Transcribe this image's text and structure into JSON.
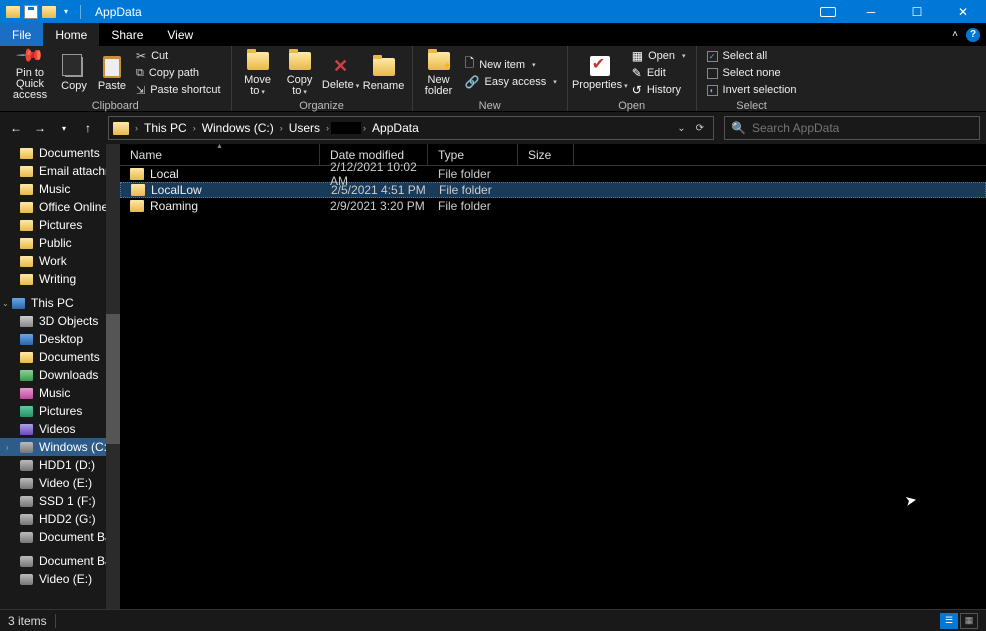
{
  "window": {
    "title": "AppData"
  },
  "menu": {
    "file": "File",
    "home": "Home",
    "share": "Share",
    "view": "View"
  },
  "ribbon": {
    "clipboard": {
      "label": "Clipboard",
      "pin": "Pin to Quick access",
      "copy": "Copy",
      "paste": "Paste",
      "cut": "Cut",
      "copy_path": "Copy path",
      "paste_shortcut": "Paste shortcut"
    },
    "organize": {
      "label": "Organize",
      "move_to": "Move to",
      "copy_to": "Copy to",
      "delete": "Delete",
      "rename": "Rename"
    },
    "new": {
      "label": "New",
      "new_folder": "New folder",
      "new_item": "New item",
      "easy_access": "Easy access"
    },
    "open": {
      "label": "Open",
      "properties": "Properties",
      "open": "Open",
      "edit": "Edit",
      "history": "History"
    },
    "select": {
      "label": "Select",
      "select_all": "Select all",
      "select_none": "Select none",
      "invert": "Invert selection"
    }
  },
  "breadcrumbs": [
    "This PC",
    "Windows (C:)",
    "Users",
    "····",
    "AppData"
  ],
  "search": {
    "placeholder": "Search AppData"
  },
  "tree": {
    "quick": [
      "Documents",
      "Email attachmen",
      "Music",
      "Office Online ex",
      "Pictures",
      "Public",
      "Work",
      "Writing"
    ],
    "thispc_label": "This PC",
    "thispc": [
      {
        "label": "3D Objects",
        "cls": "obj"
      },
      {
        "label": "Desktop",
        "cls": "pc"
      },
      {
        "label": "Documents",
        "cls": ""
      },
      {
        "label": "Downloads",
        "cls": "dl"
      },
      {
        "label": "Music",
        "cls": "mus"
      },
      {
        "label": "Pictures",
        "cls": "img"
      },
      {
        "label": "Videos",
        "cls": "vid"
      },
      {
        "label": "Windows (C:)",
        "cls": "drive",
        "sel": true
      },
      {
        "label": "HDD1 (D:)",
        "cls": "drive"
      },
      {
        "label": "Video (E:)",
        "cls": "drive"
      },
      {
        "label": "SSD 1 (F:)",
        "cls": "drive"
      },
      {
        "label": "HDD2 (G:)",
        "cls": "drive"
      },
      {
        "label": "Document Back",
        "cls": "drive"
      },
      {
        "label": "Document Back U",
        "cls": "drive"
      },
      {
        "label": "Video (E:)",
        "cls": "drive"
      }
    ]
  },
  "columns": {
    "name": "Name",
    "date": "Date modified",
    "type": "Type",
    "size": "Size"
  },
  "rows": [
    {
      "name": "Local",
      "date": "2/12/2021 10:02 AM",
      "type": "File folder"
    },
    {
      "name": "LocalLow",
      "date": "2/5/2021 4:51 PM",
      "type": "File folder",
      "selected": true
    },
    {
      "name": "Roaming",
      "date": "2/9/2021 3:20 PM",
      "type": "File folder"
    }
  ],
  "status": {
    "items": "3 items"
  }
}
